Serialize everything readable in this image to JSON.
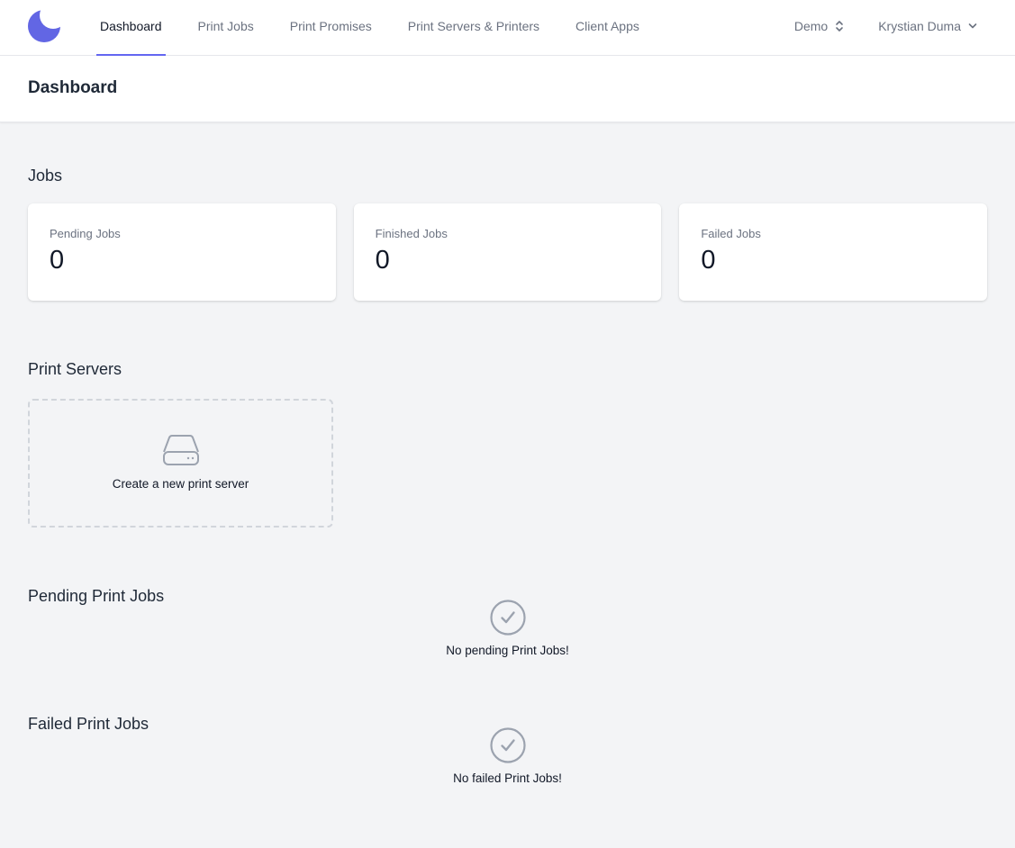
{
  "nav": {
    "links": [
      {
        "label": "Dashboard",
        "active": true
      },
      {
        "label": "Print Jobs",
        "active": false
      },
      {
        "label": "Print Promises",
        "active": false
      },
      {
        "label": "Print Servers & Printers",
        "active": false
      },
      {
        "label": "Client Apps",
        "active": false
      }
    ],
    "team": "Demo",
    "user": "Krystian Duma"
  },
  "page": {
    "title": "Dashboard"
  },
  "jobs": {
    "title": "Jobs",
    "stats": [
      {
        "label": "Pending Jobs",
        "value": "0"
      },
      {
        "label": "Finished Jobs",
        "value": "0"
      },
      {
        "label": "Failed Jobs",
        "value": "0"
      }
    ]
  },
  "print_servers": {
    "title": "Print Servers",
    "create_label": "Create a new print server"
  },
  "pending_print_jobs": {
    "title": "Pending Print Jobs",
    "empty_text": "No pending Print Jobs!"
  },
  "failed_print_jobs": {
    "title": "Failed Print Jobs",
    "empty_text": "No failed Print Jobs!"
  },
  "colors": {
    "accent": "#6366f1",
    "logo": "#5b5fe0",
    "background": "#f3f4f6",
    "muted_icon": "#9ca3af"
  },
  "icons": {
    "logo": "crescent-logo-icon",
    "team_selector": "chevron-up-down-icon",
    "user_menu": "chevron-down-icon",
    "print_server": "server-drive-icon",
    "empty_state": "check-circle-icon"
  }
}
